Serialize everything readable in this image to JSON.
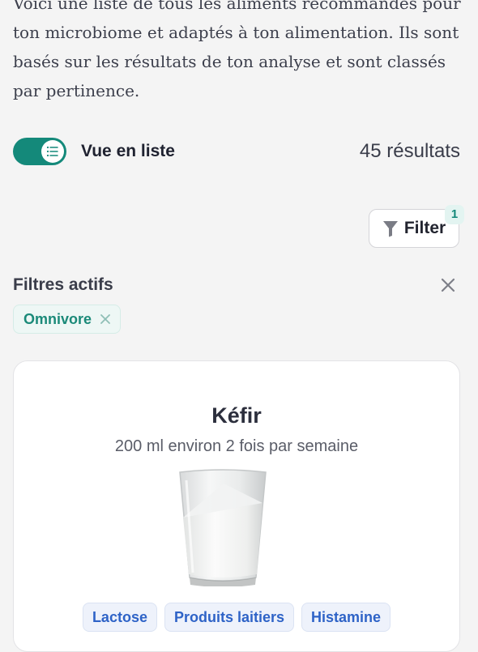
{
  "intro": {
    "text": "Voici une liste de tous les aliments recommandés pour ton microbiome et adaptés à ton alimentation. Ils sont basés sur les résultats de ton analyse et sont classés par pertinence."
  },
  "view_toggle": {
    "label": "Vue en liste",
    "state": "on",
    "icon": "list-icon"
  },
  "results_count": "45 résultats",
  "filter": {
    "button_label": "Filter",
    "badge_count": "1",
    "icon": "funnel-icon"
  },
  "active_filters": {
    "title": "Filtres actifs",
    "chips": [
      {
        "label": "Omnivore"
      }
    ]
  },
  "card": {
    "title": "Kéfir",
    "subtitle": "200 ml environ 2 fois par semaine",
    "image_icon": "glass-of-kefir",
    "tags": [
      {
        "label": "Lactose"
      },
      {
        "label": "Produits laitiers"
      },
      {
        "label": "Histamine"
      }
    ]
  },
  "colors": {
    "accent": "#14897a",
    "tag_text": "#2e63c7",
    "background": "#f4f4f4"
  }
}
